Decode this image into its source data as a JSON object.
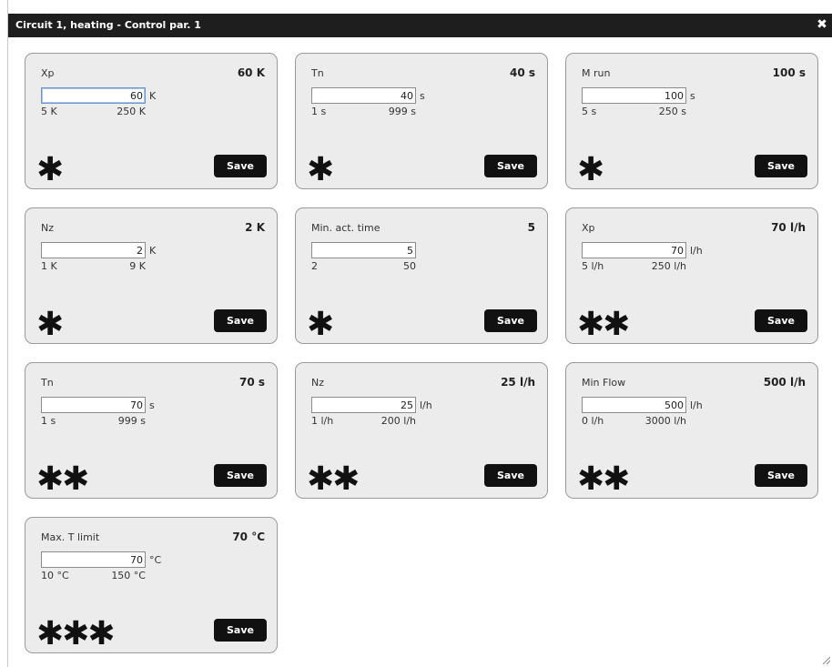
{
  "dialog": {
    "title": "Circuit 1, heating - Control par. 1",
    "close_glyph": "✖"
  },
  "save_label": "Save",
  "cards": [
    {
      "name": "Xp",
      "value": "60 K",
      "input": "60",
      "unit": "K",
      "min": "5 K",
      "max": "250 K",
      "level": "✱"
    },
    {
      "name": "Tn",
      "value": "40 s",
      "input": "40",
      "unit": "s",
      "min": "1 s",
      "max": "999 s",
      "level": "✱"
    },
    {
      "name": "M run",
      "value": "100 s",
      "input": "100",
      "unit": "s",
      "min": "5 s",
      "max": "250 s",
      "level": "✱"
    },
    {
      "name": "Nz",
      "value": "2 K",
      "input": "2",
      "unit": "K",
      "min": "1 K",
      "max": "9 K",
      "level": "✱"
    },
    {
      "name": "Min. act. time",
      "value": "5",
      "input": "5",
      "unit": "",
      "min": "2",
      "max": "50",
      "level": "✱"
    },
    {
      "name": "Xp",
      "value": "70 l/h",
      "input": "70",
      "unit": "l/h",
      "min": "5 l/h",
      "max": "250 l/h",
      "level": "✱✱"
    },
    {
      "name": "Tn",
      "value": "70 s",
      "input": "70",
      "unit": "s",
      "min": "1 s",
      "max": "999 s",
      "level": "✱✱"
    },
    {
      "name": "Nz",
      "value": "25 l/h",
      "input": "25",
      "unit": "l/h",
      "min": "1 l/h",
      "max": "200 l/h",
      "level": "✱✱"
    },
    {
      "name": "Min Flow",
      "value": "500 l/h",
      "input": "500",
      "unit": "l/h",
      "min": "0 l/h",
      "max": "3000 l/h",
      "level": "✱✱"
    },
    {
      "name": "Max. T limit",
      "value": "70 °C",
      "input": "70",
      "unit": "°C",
      "min": "10 °C",
      "max": "150 °C",
      "level": "✱✱✱"
    }
  ]
}
